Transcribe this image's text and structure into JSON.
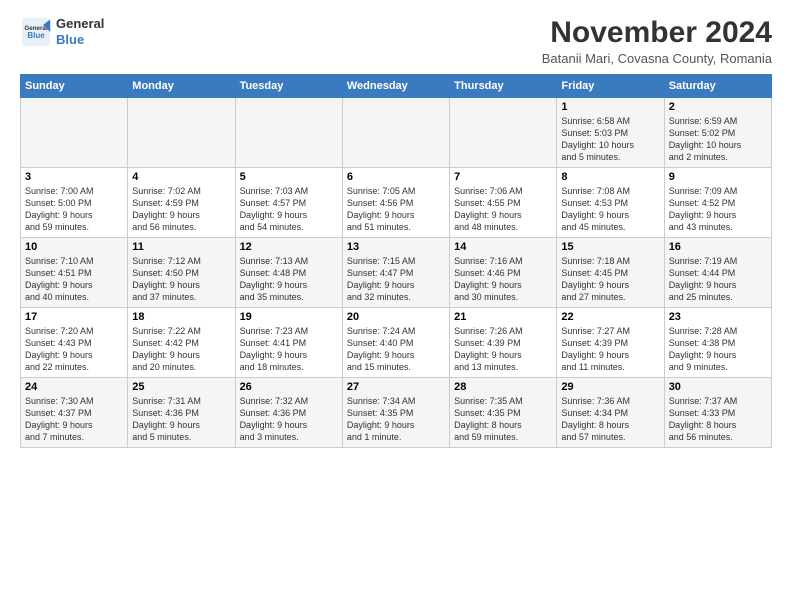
{
  "header": {
    "logo_line1": "General",
    "logo_line2": "Blue",
    "month_title": "November 2024",
    "location": "Batanii Mari, Covasna County, Romania"
  },
  "days_of_week": [
    "Sunday",
    "Monday",
    "Tuesday",
    "Wednesday",
    "Thursday",
    "Friday",
    "Saturday"
  ],
  "weeks": [
    [
      {
        "day": "",
        "info": ""
      },
      {
        "day": "",
        "info": ""
      },
      {
        "day": "",
        "info": ""
      },
      {
        "day": "",
        "info": ""
      },
      {
        "day": "",
        "info": ""
      },
      {
        "day": "1",
        "info": "Sunrise: 6:58 AM\nSunset: 5:03 PM\nDaylight: 10 hours\nand 5 minutes."
      },
      {
        "day": "2",
        "info": "Sunrise: 6:59 AM\nSunset: 5:02 PM\nDaylight: 10 hours\nand 2 minutes."
      }
    ],
    [
      {
        "day": "3",
        "info": "Sunrise: 7:00 AM\nSunset: 5:00 PM\nDaylight: 9 hours\nand 59 minutes."
      },
      {
        "day": "4",
        "info": "Sunrise: 7:02 AM\nSunset: 4:59 PM\nDaylight: 9 hours\nand 56 minutes."
      },
      {
        "day": "5",
        "info": "Sunrise: 7:03 AM\nSunset: 4:57 PM\nDaylight: 9 hours\nand 54 minutes."
      },
      {
        "day": "6",
        "info": "Sunrise: 7:05 AM\nSunset: 4:56 PM\nDaylight: 9 hours\nand 51 minutes."
      },
      {
        "day": "7",
        "info": "Sunrise: 7:06 AM\nSunset: 4:55 PM\nDaylight: 9 hours\nand 48 minutes."
      },
      {
        "day": "8",
        "info": "Sunrise: 7:08 AM\nSunset: 4:53 PM\nDaylight: 9 hours\nand 45 minutes."
      },
      {
        "day": "9",
        "info": "Sunrise: 7:09 AM\nSunset: 4:52 PM\nDaylight: 9 hours\nand 43 minutes."
      }
    ],
    [
      {
        "day": "10",
        "info": "Sunrise: 7:10 AM\nSunset: 4:51 PM\nDaylight: 9 hours\nand 40 minutes."
      },
      {
        "day": "11",
        "info": "Sunrise: 7:12 AM\nSunset: 4:50 PM\nDaylight: 9 hours\nand 37 minutes."
      },
      {
        "day": "12",
        "info": "Sunrise: 7:13 AM\nSunset: 4:48 PM\nDaylight: 9 hours\nand 35 minutes."
      },
      {
        "day": "13",
        "info": "Sunrise: 7:15 AM\nSunset: 4:47 PM\nDaylight: 9 hours\nand 32 minutes."
      },
      {
        "day": "14",
        "info": "Sunrise: 7:16 AM\nSunset: 4:46 PM\nDaylight: 9 hours\nand 30 minutes."
      },
      {
        "day": "15",
        "info": "Sunrise: 7:18 AM\nSunset: 4:45 PM\nDaylight: 9 hours\nand 27 minutes."
      },
      {
        "day": "16",
        "info": "Sunrise: 7:19 AM\nSunset: 4:44 PM\nDaylight: 9 hours\nand 25 minutes."
      }
    ],
    [
      {
        "day": "17",
        "info": "Sunrise: 7:20 AM\nSunset: 4:43 PM\nDaylight: 9 hours\nand 22 minutes."
      },
      {
        "day": "18",
        "info": "Sunrise: 7:22 AM\nSunset: 4:42 PM\nDaylight: 9 hours\nand 20 minutes."
      },
      {
        "day": "19",
        "info": "Sunrise: 7:23 AM\nSunset: 4:41 PM\nDaylight: 9 hours\nand 18 minutes."
      },
      {
        "day": "20",
        "info": "Sunrise: 7:24 AM\nSunset: 4:40 PM\nDaylight: 9 hours\nand 15 minutes."
      },
      {
        "day": "21",
        "info": "Sunrise: 7:26 AM\nSunset: 4:39 PM\nDaylight: 9 hours\nand 13 minutes."
      },
      {
        "day": "22",
        "info": "Sunrise: 7:27 AM\nSunset: 4:39 PM\nDaylight: 9 hours\nand 11 minutes."
      },
      {
        "day": "23",
        "info": "Sunrise: 7:28 AM\nSunset: 4:38 PM\nDaylight: 9 hours\nand 9 minutes."
      }
    ],
    [
      {
        "day": "24",
        "info": "Sunrise: 7:30 AM\nSunset: 4:37 PM\nDaylight: 9 hours\nand 7 minutes."
      },
      {
        "day": "25",
        "info": "Sunrise: 7:31 AM\nSunset: 4:36 PM\nDaylight: 9 hours\nand 5 minutes."
      },
      {
        "day": "26",
        "info": "Sunrise: 7:32 AM\nSunset: 4:36 PM\nDaylight: 9 hours\nand 3 minutes."
      },
      {
        "day": "27",
        "info": "Sunrise: 7:34 AM\nSunset: 4:35 PM\nDaylight: 9 hours\nand 1 minute."
      },
      {
        "day": "28",
        "info": "Sunrise: 7:35 AM\nSunset: 4:35 PM\nDaylight: 8 hours\nand 59 minutes."
      },
      {
        "day": "29",
        "info": "Sunrise: 7:36 AM\nSunset: 4:34 PM\nDaylight: 8 hours\nand 57 minutes."
      },
      {
        "day": "30",
        "info": "Sunrise: 7:37 AM\nSunset: 4:33 PM\nDaylight: 8 hours\nand 56 minutes."
      }
    ]
  ]
}
